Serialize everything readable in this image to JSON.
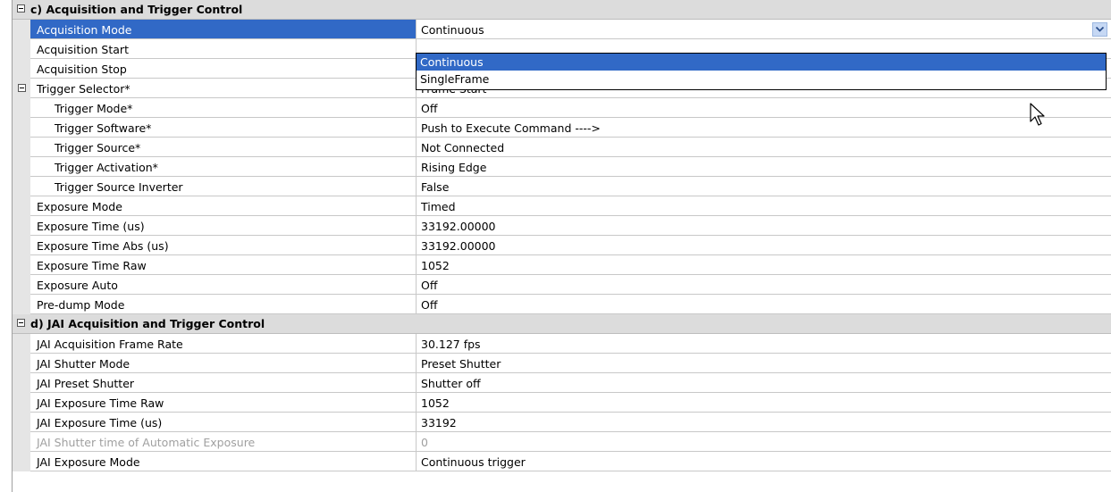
{
  "sections": {
    "c": {
      "title": "c) Acquisition and Trigger Control"
    },
    "d": {
      "title": "d) JAI Acquisition and Trigger Control"
    }
  },
  "rows": [
    {
      "name": "Acquisition Mode",
      "value": "Continuous"
    },
    {
      "name": "Acquisition Start",
      "value": ""
    },
    {
      "name": "Acquisition Stop",
      "value": ""
    },
    {
      "name": "Trigger Selector*",
      "value": "Frame Start"
    },
    {
      "name": "Trigger Mode*",
      "value": "Off"
    },
    {
      "name": "Trigger Software*",
      "value": "Push to Execute Command ---->"
    },
    {
      "name": "Trigger Source*",
      "value": "Not Connected"
    },
    {
      "name": "Trigger Activation*",
      "value": "Rising Edge"
    },
    {
      "name": "Trigger Source Inverter",
      "value": "False"
    },
    {
      "name": "Exposure Mode",
      "value": "Timed"
    },
    {
      "name": "Exposure Time (us)",
      "value": "33192.00000"
    },
    {
      "name": "Exposure Time Abs (us)",
      "value": "33192.00000"
    },
    {
      "name": "Exposure Time Raw",
      "value": "1052"
    },
    {
      "name": "Exposure Auto",
      "value": "Off"
    },
    {
      "name": "Pre-dump Mode",
      "value": "Off"
    },
    {
      "name": "JAI Acquisition Frame Rate",
      "value": "30.127 fps"
    },
    {
      "name": "JAI Shutter Mode",
      "value": "Preset Shutter"
    },
    {
      "name": "JAI Preset Shutter",
      "value": "Shutter off"
    },
    {
      "name": "JAI Exposure Time Raw",
      "value": "1052"
    },
    {
      "name": "JAI Exposure Time (us)",
      "value": "33192"
    },
    {
      "name": "JAI Shutter time of Automatic Exposure",
      "value": "0"
    },
    {
      "name": "JAI Exposure Mode",
      "value": "Continuous trigger"
    }
  ],
  "dropdown": {
    "options": [
      "Continuous",
      "SingleFrame"
    ],
    "highlighted": "Continuous"
  },
  "icons": {
    "collapse": "collapse-toggle-icon",
    "dropdown_arrow": "chevron-down-icon",
    "cursor": "mouse-cursor-icon"
  },
  "colors": {
    "selection": "#3169c6",
    "section_bg": "#dcdcdc"
  }
}
